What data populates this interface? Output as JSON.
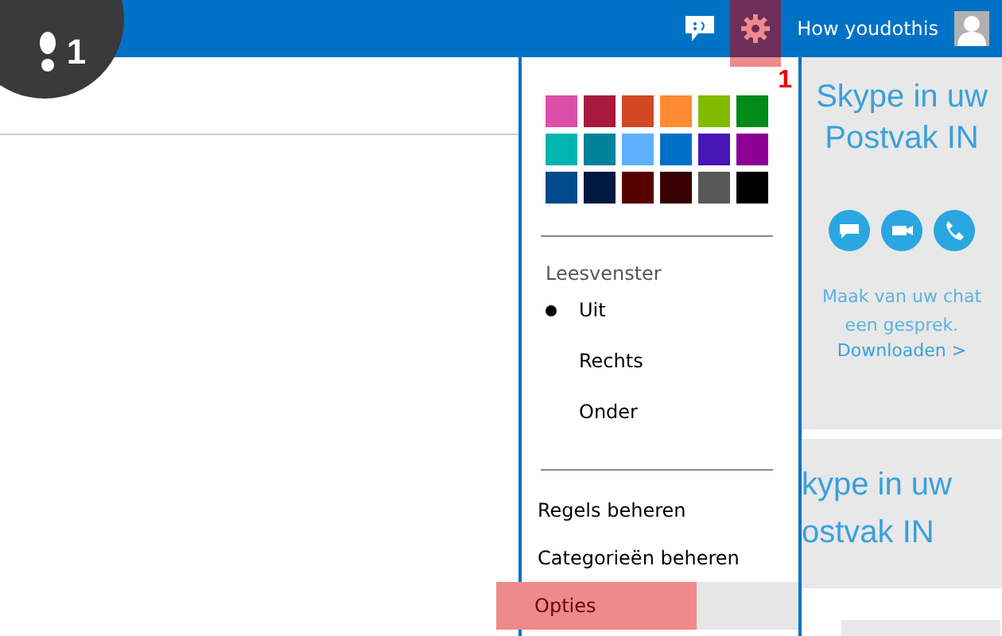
{
  "header": {
    "user_name": "How youdothis",
    "settings_highlighted": true
  },
  "step_badge": "1",
  "annotation": "1",
  "theme_colors": [
    {
      "color": "#dd4ea9"
    },
    {
      "color": "#a8193c"
    },
    {
      "color": "#d24726"
    },
    {
      "color": "#ff8c32"
    },
    {
      "color": "#81ba00"
    },
    {
      "color": "#008a17"
    },
    {
      "color": "#00b4b0"
    },
    {
      "color": "#00829a"
    },
    {
      "color": "#5eb0ff"
    },
    {
      "color": "#0072c6"
    },
    {
      "color": "#4617b4"
    },
    {
      "color": "#8c0095"
    },
    {
      "color": "#004b8b"
    },
    {
      "color": "#001940"
    },
    {
      "color": "#570000"
    },
    {
      "color": "#380000"
    },
    {
      "color": "#585858"
    },
    {
      "color": "#000000"
    }
  ],
  "reading_pane": {
    "title": "Leesvenster",
    "options": [
      {
        "label": "Uit",
        "selected": true
      },
      {
        "label": "Rechts",
        "selected": false
      },
      {
        "label": "Onder",
        "selected": false
      }
    ]
  },
  "menu_items": [
    {
      "label": "Regels beheren",
      "highlighted": false
    },
    {
      "label": "Categorieën beheren",
      "highlighted": false
    },
    {
      "label": "Opties",
      "highlighted": true
    }
  ],
  "skype_ad": {
    "title": "Skype in uw Postvak IN",
    "text": "Maak van uw chat een gesprek.",
    "link": "Downloaden >"
  },
  "skype_ad_2": {
    "lines": [
      "kype in uw",
      "ostvak IN"
    ]
  }
}
